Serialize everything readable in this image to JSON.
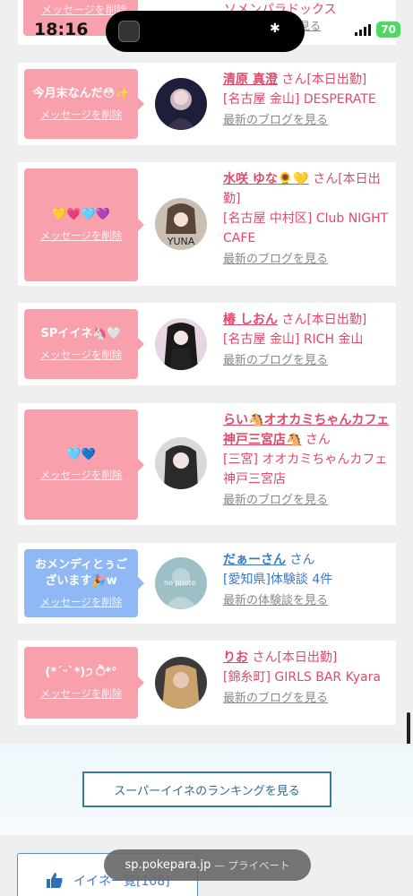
{
  "status_bar": {
    "time": "18:16",
    "battery": "70"
  },
  "partial_card": {
    "name": "ソメンパラドックス",
    "blog": "最新のブログを見る",
    "delete": "メッセージを削除"
  },
  "cards": [
    {
      "message": "今月末なんだ😳✨",
      "delete": "メッセージを削除",
      "name": "清原 真澄",
      "suffix": "さん[本日出勤]",
      "shop": "[名古屋 金山] DESPERATE",
      "blog": "最新のブログを見る",
      "theme": "pink"
    },
    {
      "message": "💛💗🩵💜",
      "delete": "メッセージを削除",
      "name": "水咲 ゆな🌻💛",
      "suffix": "さん[本日出勤]",
      "shop": "[名古屋 中村区] Club NIGHT CAFE",
      "blog": "最新のブログを見る",
      "theme": "pink"
    },
    {
      "message": "SPイイネ🦄🤍",
      "delete": "メッセージを削除",
      "name": "椿 しおん",
      "suffix": "さん[本日出勤]",
      "shop": "[名古屋 金山] RICH 金山",
      "blog": "最新のブログを見る",
      "theme": "pink"
    },
    {
      "message": "🩵💙",
      "delete": "メッセージを削除",
      "name": "らい🐴オオカミちゃんカフェ神戸三宮店🐴",
      "suffix": "さん",
      "shop": "[三宮] オオカミちゃんカフェ神戸三宮店",
      "blog": "最新のブログを見る",
      "theme": "pink"
    },
    {
      "message": "おメンディとぅございます🎉w",
      "delete": "メッセージを削除",
      "name": "だぁーさん",
      "suffix": "さん",
      "shop": "[愛知県]体験談 4件",
      "blog": "最新の体験談を見る",
      "theme": "blue",
      "avatar_text": "no photo"
    },
    {
      "message": "(*ˊᵕˋ*)੭ ੈ*°",
      "delete": "メッセージを削除",
      "name": "りお",
      "suffix": "さん[本日出勤]",
      "shop": "[錦糸町] GIRLS BAR Kyara",
      "blog": "最新のブログを見る",
      "theme": "pink"
    }
  ],
  "ranking": {
    "button": "スーパーイイネのランキングを見る"
  },
  "bottom": {
    "label": "イイネ一覧[108]"
  },
  "url_bar": {
    "domain": "sp.pokepara.jp",
    "mode": "— プライベート"
  }
}
